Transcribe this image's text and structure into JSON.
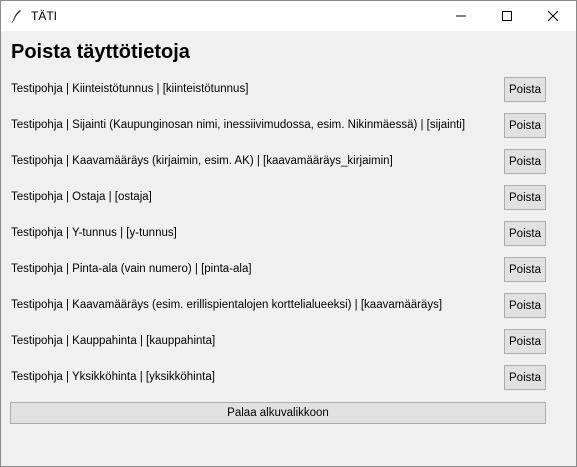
{
  "window": {
    "title": "TÄTI"
  },
  "heading": "Poista täyttötietoja",
  "rows": [
    {
      "label": "Testipohja  |  Kiinteistötunnus  |  [kiinteistötunnus]",
      "button": "Poista"
    },
    {
      "label": "Testipohja  |  Sijainti (Kaupunginosan nimi, inessiivimudossa, esim. Nikinmäessä)  |  [sijainti]",
      "button": "Poista"
    },
    {
      "label": "Testipohja  |  Kaavamääräys (kirjaimin, esim. AK)  |  [kaavamääräys_kirjaimin]",
      "button": "Poista"
    },
    {
      "label": "Testipohja  |  Ostaja  |  [ostaja]",
      "button": "Poista"
    },
    {
      "label": "Testipohja  |  Y-tunnus  |  [y-tunnus]",
      "button": "Poista"
    },
    {
      "label": "Testipohja  |  Pinta-ala (vain numero)  |  [pinta-ala]",
      "button": "Poista"
    },
    {
      "label": "Testipohja  |  Kaavamääräys (esim. erillispientalojen korttelialueeksi)  |  [kaavamääräys]",
      "button": "Poista"
    },
    {
      "label": "Testipohja  |  Kauppahinta  |  [kauppahinta]",
      "button": "Poista"
    },
    {
      "label": "Testipohja  |  Yksikköhinta  |  [yksikköhinta]",
      "button": "Poista"
    }
  ],
  "back_button": "Palaa alkuvalikkoon"
}
